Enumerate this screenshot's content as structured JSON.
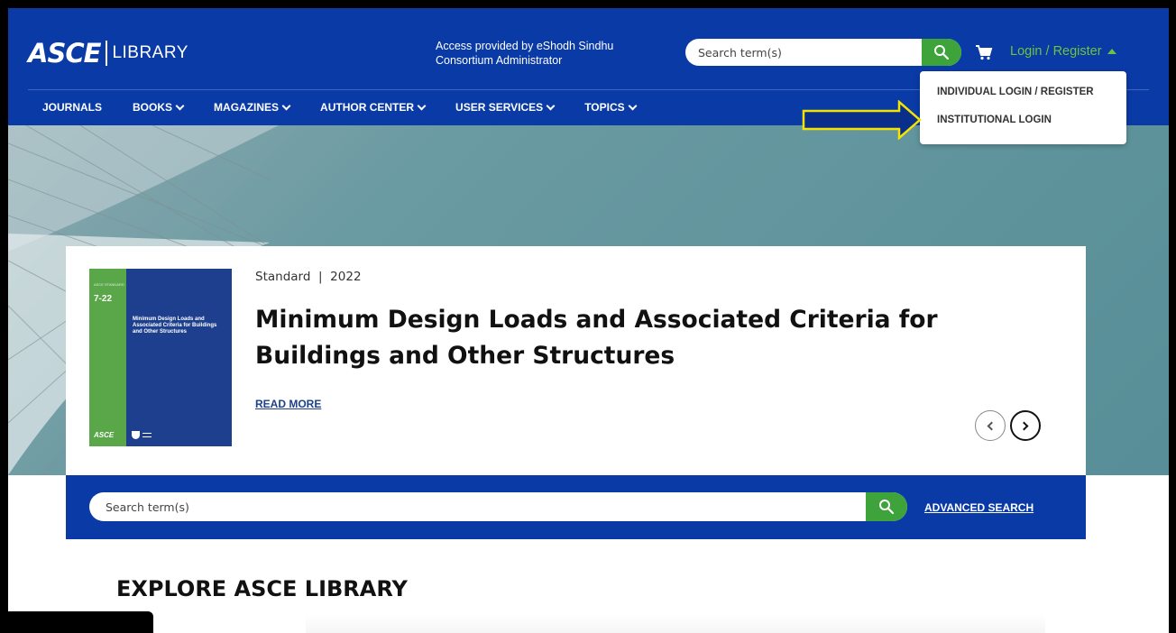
{
  "header": {
    "logo_brand": "ASCE",
    "logo_library": "LIBRARY",
    "access_line1": "Access provided by eShodh Sindhu",
    "access_line2": "Consortium Administrator",
    "search_placeholder": "Search term(s)",
    "login_label": "Login / Register"
  },
  "nav": {
    "items": [
      {
        "label": "JOURNALS",
        "has_dropdown": false
      },
      {
        "label": "BOOKS",
        "has_dropdown": true
      },
      {
        "label": "MAGAZINES",
        "has_dropdown": true
      },
      {
        "label": "AUTHOR CENTER",
        "has_dropdown": true
      },
      {
        "label": "USER SERVICES",
        "has_dropdown": true
      },
      {
        "label": "TOPICS",
        "has_dropdown": true
      }
    ]
  },
  "login_dropdown": {
    "items": [
      "INDIVIDUAL LOGIN / REGISTER",
      "INSTITUTIONAL LOGIN"
    ]
  },
  "hero": {
    "meta_type": "Standard",
    "meta_sep": "|",
    "meta_year": "2022",
    "title": "Minimum Design Loads and Associated Criteria for Buildings and Other Structures",
    "read_more": "READ MORE",
    "cover_number": "7-22",
    "cover_title": "Minimum Design Loads and Associated Criteria for Buildings and Other Structures",
    "cover_brand": "ASCE"
  },
  "band_search": {
    "placeholder": "Search term(s)",
    "advanced_label": "ADVANCED SEARCH"
  },
  "explore_title": "EXPLORE ASCE LIBRARY",
  "icons": {
    "search": "search-icon",
    "cart": "cart-icon",
    "caret": "caret-up-icon",
    "prev": "chevron-left-icon",
    "next": "chevron-right-icon"
  },
  "colors": {
    "header_blue": "#0a3aa6",
    "accent_green": "#3ea33a",
    "login_green": "#6bc43d",
    "callout_yellow": "#f2e400"
  }
}
